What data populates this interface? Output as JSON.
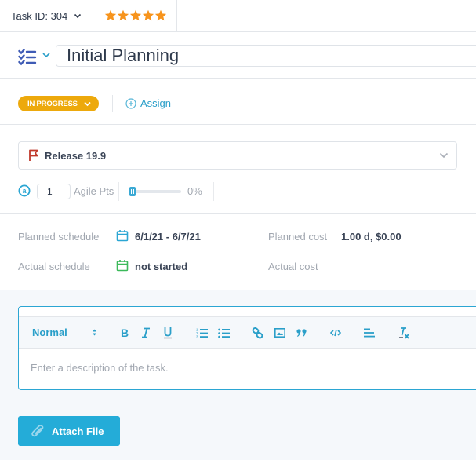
{
  "header": {
    "task_id_label": "Task ID: 304",
    "rating": {
      "value": 5,
      "max": 5,
      "color": "#f7941d"
    }
  },
  "task": {
    "type_icon": "checklist-icon",
    "title": "Initial Planning"
  },
  "status": {
    "label": "IN PROGRESS",
    "color": "#eda90c",
    "assign_label": "Assign"
  },
  "release": {
    "icon": "flag-icon",
    "label": "Release 19.9"
  },
  "agile": {
    "icon": "agile-points-icon",
    "value": "1",
    "label": "Agile Pts",
    "progress_percent": 0,
    "progress_label": "0%"
  },
  "schedule": {
    "planned_schedule_label": "Planned schedule",
    "planned_schedule_value": "6/1/21 - 6/7/21",
    "actual_schedule_label": "Actual schedule",
    "actual_schedule_value": "not started",
    "planned_cost_label": "Planned cost",
    "planned_cost_value": "1.00 d, $0.00",
    "actual_cost_label": "Actual cost",
    "actual_cost_value": ""
  },
  "editor": {
    "format_select": "Normal",
    "toolbar_icons": [
      "bold-icon",
      "italic-icon",
      "underline-icon",
      "ordered-list-icon",
      "bullet-list-icon",
      "link-icon",
      "image-icon",
      "blockquote-icon",
      "code-icon",
      "align-icon",
      "clear-format-icon"
    ],
    "placeholder": "Enter a description of the task."
  },
  "attach_button_label": "Attach File",
  "colors": {
    "accent": "#2a9fc9",
    "button": "#24acd8",
    "flag": "#c0392b",
    "planned_calendar": "#2ba6d3",
    "actual_calendar": "#3cb95a"
  }
}
